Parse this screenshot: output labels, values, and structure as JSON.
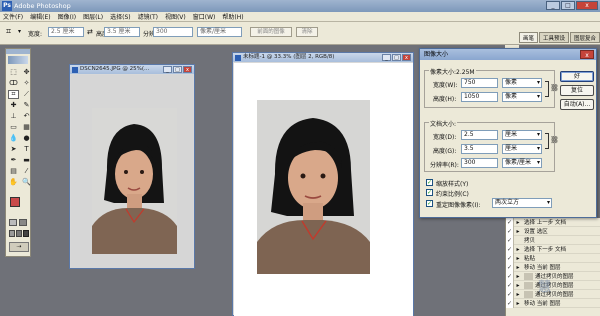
{
  "app": {
    "title": "Adobe Photoshop",
    "logo": "Ps"
  },
  "menu": [
    "文件(F)",
    "编辑(E)",
    "图像(I)",
    "图层(L)",
    "选择(S)",
    "滤镜(T)",
    "视图(V)",
    "窗口(W)",
    "帮助(H)"
  ],
  "options": {
    "width_label": "宽度:",
    "width_value": "2.5 厘米",
    "height_label": "高度:",
    "height_value": "3.5 厘米",
    "resolution_label": "分辨率:",
    "resolution_value": "300",
    "resolution_unit": "像素/厘米",
    "front_image_btn": "前面的图像",
    "clear_btn": "清除",
    "palette_tabs": [
      "画笔",
      "工具预设",
      "图层复合"
    ]
  },
  "documents": [
    {
      "title": "DSCN2645.JPG @ 25%(...",
      "buttons": [
        "_",
        "□",
        "x"
      ]
    },
    {
      "title": "未标题-1 @ 33.3% (图层 2, RGB/8)",
      "buttons": [
        "_",
        "□",
        "x"
      ]
    }
  ],
  "dialog": {
    "title": "图像大小",
    "close": "x",
    "pixel_dimensions_label": "像素大小:2.25M",
    "pixel_width_label": "宽度(W):",
    "pixel_width_value": "750",
    "pixel_width_unit": "像素",
    "pixel_height_label": "高度(H):",
    "pixel_height_value": "1050",
    "pixel_height_unit": "像素",
    "document_size_label": "文档大小:",
    "doc_width_label": "宽度(D):",
    "doc_width_value": "2.5",
    "doc_width_unit": "厘米",
    "doc_height_label": "高度(G):",
    "doc_height_value": "3.5",
    "doc_height_unit": "厘米",
    "doc_res_label": "分辨率(R):",
    "doc_res_value": "300",
    "doc_res_unit": "像素/厘米",
    "scale_styles_label": "缩放样式(Y)",
    "scale_styles_checked": true,
    "constrain_label": "约束比例(C)",
    "constrain_checked": true,
    "resample_label": "重定图像像素(I):",
    "resample_checked": true,
    "resample_method": "两次立方",
    "ok_label": "好",
    "reset_label": "复位",
    "auto_label": "自动(A)..."
  },
  "history": [
    {
      "text": "选择 上一步 文档",
      "checked": true
    },
    {
      "text": "设置 选区",
      "checked": true
    },
    {
      "text": "拷贝",
      "checked": true
    },
    {
      "text": "选择 下一步 文档",
      "checked": true
    },
    {
      "text": "粘贴",
      "checked": true
    },
    {
      "text": "移动 当前 图层",
      "checked": true
    },
    {
      "text": "通过拷贝的图层",
      "checked": true
    },
    {
      "text": "通过拷贝的图层",
      "checked": true
    },
    {
      "text": "通过拷贝的图层",
      "checked": true
    },
    {
      "text": "移动 当前 图层",
      "checked": true
    }
  ],
  "colors": {
    "titlebar": "#8aa6cf",
    "chrome": "#ece9d8",
    "workspace": "#6f7178",
    "foreground": "#c94a4a",
    "background": "#ffffff"
  },
  "watermark": "慧"
}
